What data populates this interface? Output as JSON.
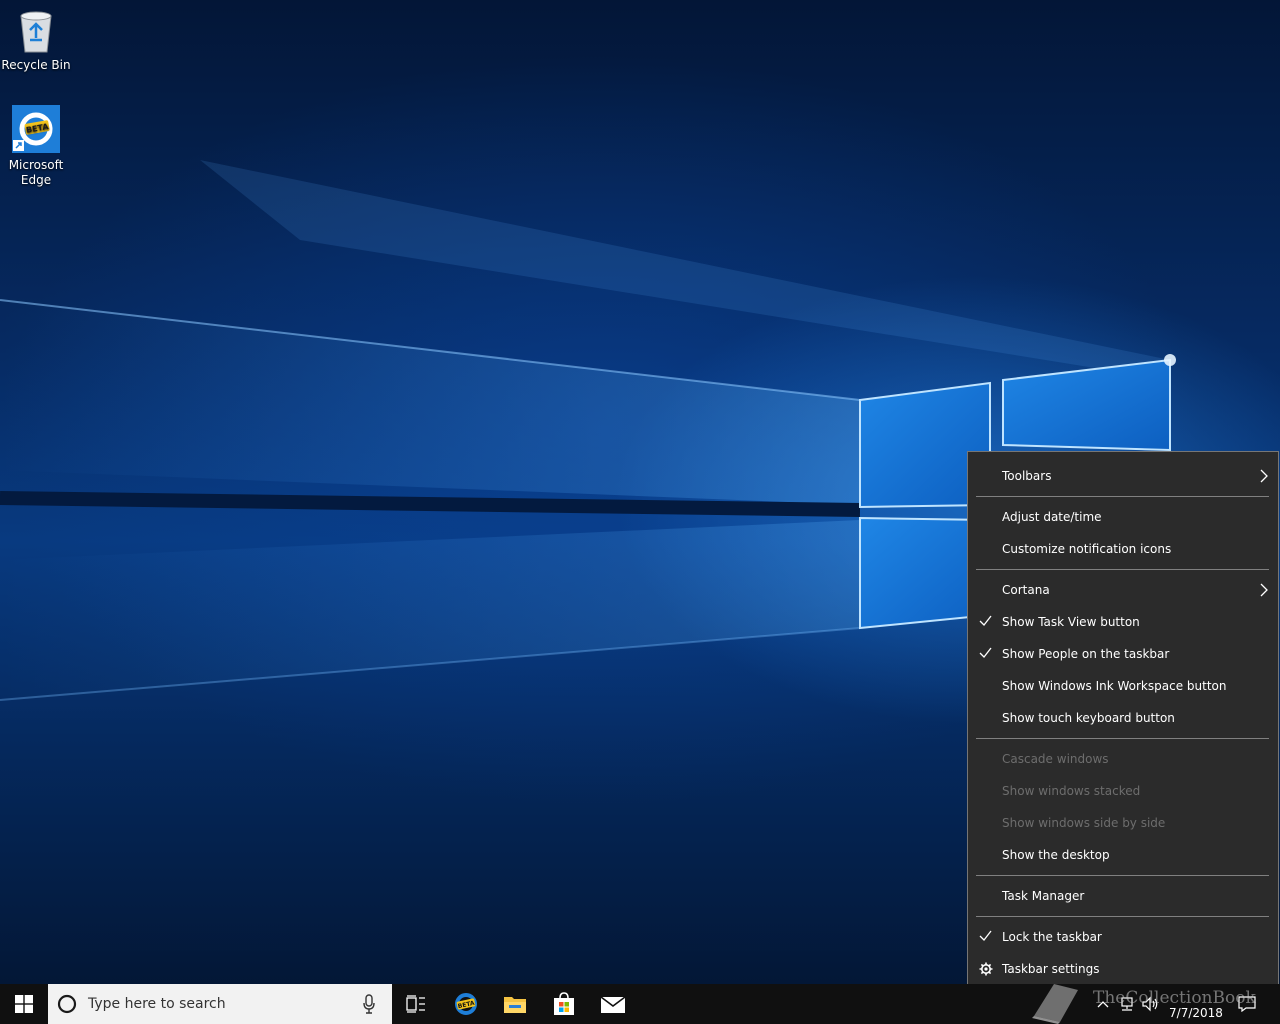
{
  "desktop": {
    "icons": [
      {
        "label": "Recycle Bin",
        "icon": "recycle-bin-icon"
      },
      {
        "label": "Microsoft Edge",
        "icon": "edge-beta-icon",
        "badge": "BETA"
      }
    ]
  },
  "context_menu": {
    "items": [
      {
        "label": "Toolbars",
        "submenu": true
      },
      {
        "label": "Adjust date/time"
      },
      {
        "label": "Customize notification icons"
      },
      {
        "label": "Cortana",
        "submenu": true
      },
      {
        "label": "Show Task View button",
        "checked": true
      },
      {
        "label": "Show People on the taskbar",
        "checked": true
      },
      {
        "label": "Show Windows Ink Workspace button"
      },
      {
        "label": "Show touch keyboard button"
      },
      {
        "label": "Cascade windows",
        "disabled": true
      },
      {
        "label": "Show windows stacked",
        "disabled": true
      },
      {
        "label": "Show windows side by side",
        "disabled": true
      },
      {
        "label": "Show the desktop"
      },
      {
        "label": "Task Manager"
      },
      {
        "label": "Lock the taskbar",
        "checked": true
      },
      {
        "label": "Taskbar settings",
        "icon": "gear-icon"
      }
    ]
  },
  "taskbar": {
    "search_placeholder": "Type here to search",
    "edge_badge": "BETA",
    "clock_time": "",
    "clock_date": "7/7/2018",
    "watermark": "TheCollectionBook"
  },
  "colors": {
    "menu_bg": "#2b2b2b",
    "menu_disabled_text": "#6d6d6d",
    "taskbar_bg": "#101010",
    "accent": "#0078d7"
  }
}
